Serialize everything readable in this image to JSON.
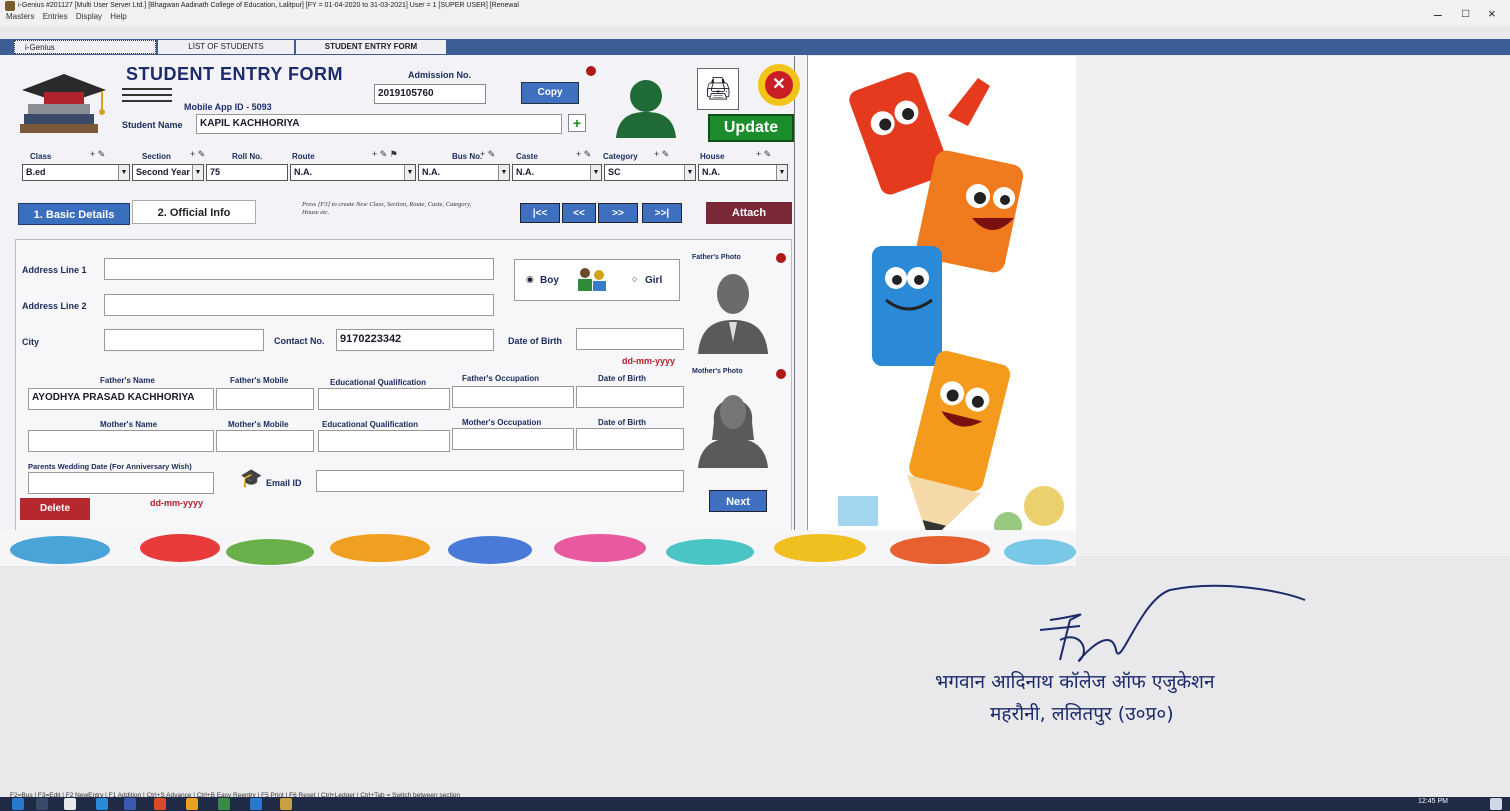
{
  "window": {
    "title": "i-Genius #201127 [Multi User Server Ltd.] [Bhagwan Aadinath College of Education, Lalitpur] [FY = 01-04-2020 to 31-03-2021] User = 1 [SUPER USER] [Renewal",
    "menu": [
      "Masters",
      "Entries",
      "Display",
      "Help"
    ]
  },
  "tabs": {
    "genius": "i-Genius",
    "list": "LIST OF STUDENTS",
    "form": "STUDENT ENTRY FORM"
  },
  "form": {
    "title": "STUDENT ENTRY FORM",
    "mobile_app_id": "Mobile App ID - 5093",
    "admission_label": "Admission No.",
    "admission_no": "2019105760",
    "copy_label": "Copy",
    "student_name_label": "Student Name",
    "student_name": "KAPIL KACHHORIYA",
    "update_label": "Update"
  },
  "fields": {
    "class": {
      "label": "Class",
      "value": "B.ed"
    },
    "section": {
      "label": "Section",
      "value": "Second Year"
    },
    "rollno": {
      "label": "Roll No.",
      "value": "75"
    },
    "route": {
      "label": "Route",
      "value": "N.A."
    },
    "busno": {
      "label": "Bus No.",
      "value": "N.A."
    },
    "caste": {
      "label": "Caste",
      "value": "N.A."
    },
    "category": {
      "label": "Category",
      "value": "SC"
    },
    "house": {
      "label": "House",
      "value": "N.A."
    }
  },
  "nav": {
    "basic": "1. Basic Details",
    "official": "2. Official Info",
    "hint": "Press [F3] to create New Class, Section, Route, Caste, Category, House etc.",
    "first": "|<<",
    "prev": "<<",
    "next": ">>",
    "last": ">>|",
    "attach": "Attach"
  },
  "details": {
    "address1_label": "Address Line 1",
    "address2_label": "Address Line 2",
    "city_label": "City",
    "contact_label": "Contact No.",
    "contact_value": "9170223342",
    "dob_label": "Date of Birth",
    "date_format": "dd-mm-yyyy",
    "boy_label": "Boy",
    "girl_label": "Girl",
    "fathers_photo": "Father's Photo",
    "mothers_photo": "Mother's Photo",
    "father_name_label": "Father's Name",
    "father_name": "AYODHYA PRASAD KACHHORIYA",
    "father_mobile_label": "Father's Mobile",
    "edu_qual_label": "Educational Qualification",
    "father_occ_label": "Father's Occupation",
    "mother_name_label": "Mother's Name",
    "mother_mobile_label": "Mother's Mobile",
    "mother_occ_label": "Mother's Occupation",
    "wedding_label": "Parents Wedding Date (For Anniversary Wish)",
    "email_label": "Email ID",
    "delete_label": "Delete",
    "next_label": "Next"
  },
  "signature": {
    "line1": "भगवान आदिनाथ कॉलेज ऑफ एजुकेशन",
    "line2": "महरौनी, ललितपुर (उ०प्र०)"
  },
  "shortcuts": "F2=Bus | F3=Edit | F2 NewEntry | F1 Addition | Ctrl+S Advance | Ctrl+B Easy Reentry | F5 Print | F6 Reset | Ctrl+Ledger | Ctrl+Tab = Switch between section",
  "clock": "12:45 PM"
}
